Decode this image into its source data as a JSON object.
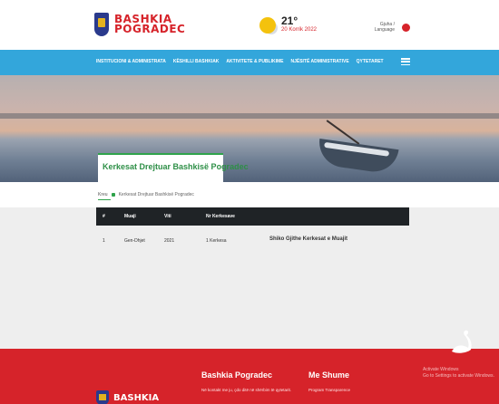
{
  "header": {
    "logo_line1": "BASHKIA",
    "logo_line2": "POGRADEC",
    "weather": {
      "temperature": "21°",
      "date": "20 Korrik 2022",
      "icon": "sun-cloud-icon"
    },
    "language": {
      "label": "Gjuha / Language",
      "flag_icon": "albania-flag-icon"
    }
  },
  "nav": {
    "items": [
      {
        "label": "INSTITUCIONI & ADMINISTRATA"
      },
      {
        "label": "KËSHILLI BASHKIAK"
      },
      {
        "label": "AKTIVITETE & PUBLIKIME"
      },
      {
        "label": "NJËSITË ADMINISTRATIVE"
      },
      {
        "label": "QYTETARET"
      }
    ],
    "menu_icon": "hamburger-icon"
  },
  "page": {
    "title": "Kerkesat Drejtuar Bashkisë Pogradec",
    "breadcrumb": {
      "home": "Kreu",
      "current": "Kerkesat Drejtuar Bashkisë Pogradec"
    }
  },
  "table": {
    "columns": [
      "#",
      "Muaji",
      "Viti",
      "Nr Kerkesave"
    ],
    "rows": [
      {
        "index": "1",
        "month": "Gen-Dhjet",
        "year": "2021",
        "count": "1 Kerkesa",
        "link": "Shiko Gjithe Kerkesat e Muajit"
      }
    ]
  },
  "footer": {
    "col1_title": "Bashkia Pogradec",
    "col1_text": "Në kontakt me ju, çdo ditë në shërbim të qytetarit.",
    "col2_title": "Me Shume",
    "col2_text": "Program Transparence",
    "logo_word": "BASHKIA",
    "swan_icon": "swan-icon",
    "watermark_line1": "Activate Windows",
    "watermark_line2": "Go to Settings to activate Windows."
  },
  "colors": {
    "brand_red": "#d6232a",
    "nav_blue": "#33a6db",
    "accent_green": "#2fa34b",
    "table_header": "#1f2326"
  }
}
